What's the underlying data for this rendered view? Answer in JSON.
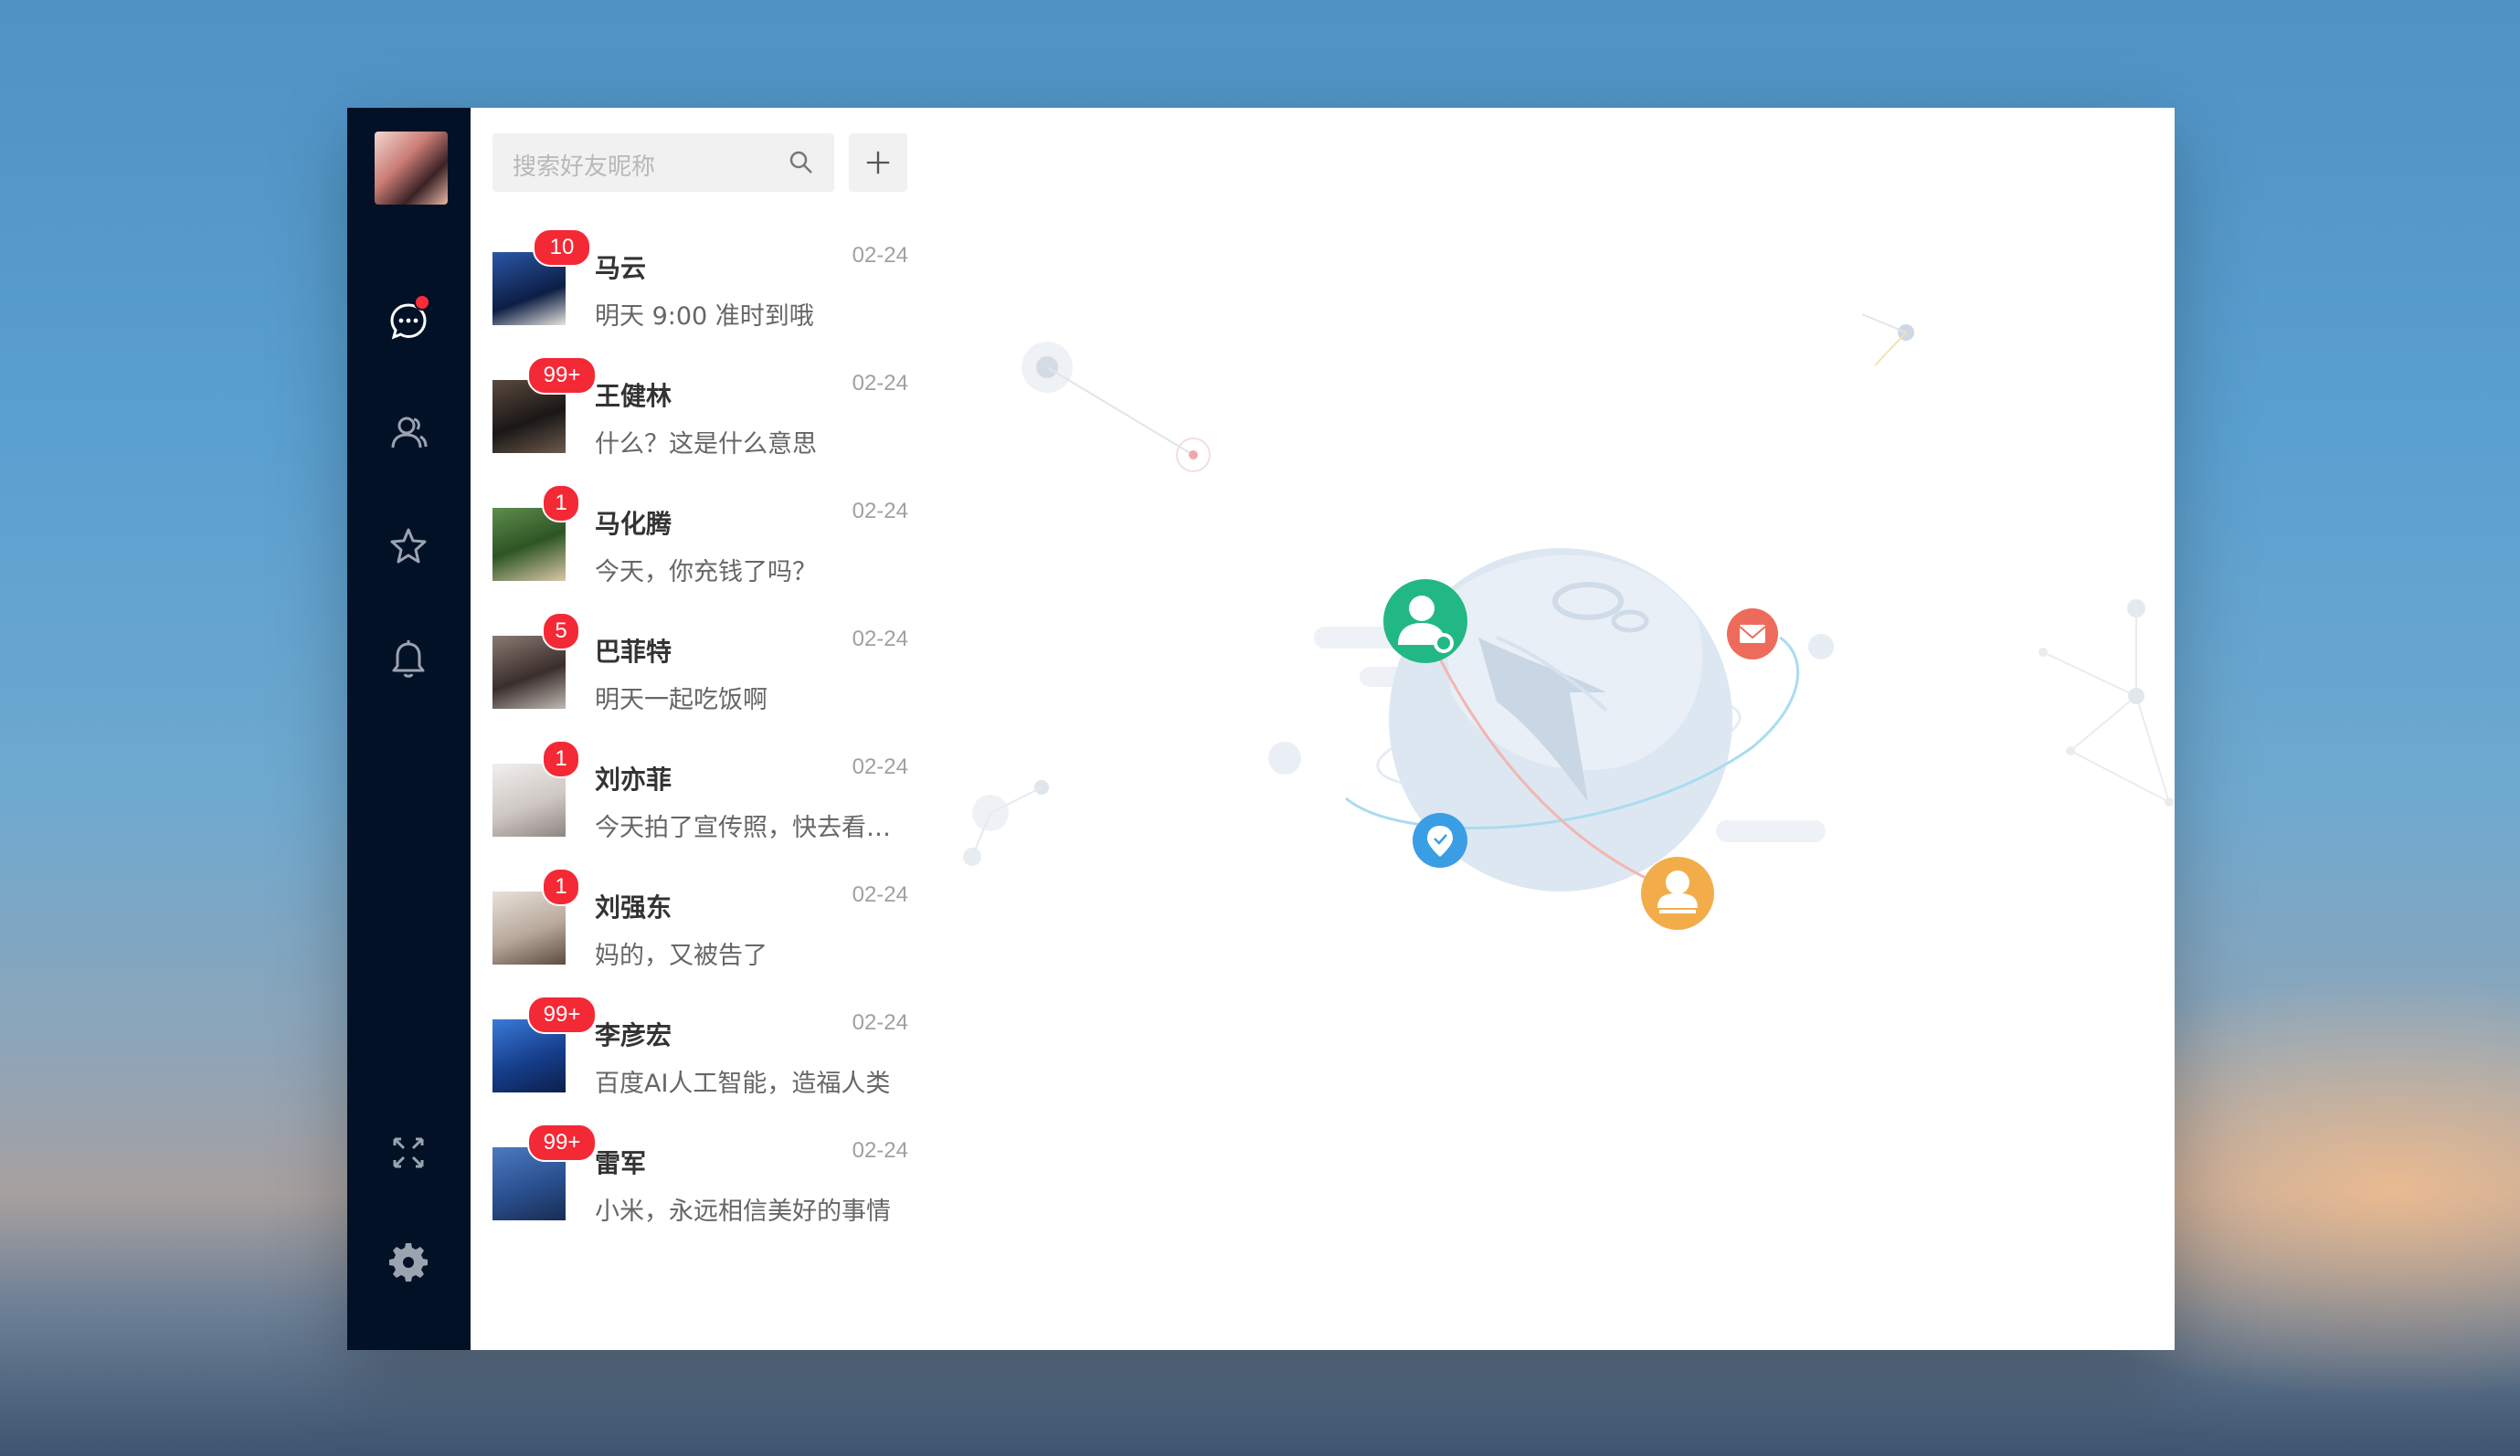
{
  "search": {
    "placeholder": "搜索好友昵称"
  },
  "conversations": [
    {
      "name": "马云",
      "time": "02-24",
      "message": "明天 9:00 准时到哦",
      "unread": "10",
      "avatar_color": "#1d3b78"
    },
    {
      "name": "王健林",
      "time": "02-24",
      "message": "什么？这是什么意思",
      "unread": "99+",
      "avatar_color": "#2a2622"
    },
    {
      "name": "马化腾",
      "time": "02-24",
      "message": "今天，你充钱了吗？",
      "unread": "1",
      "avatar_color": "#3f6e3a"
    },
    {
      "name": "巴菲特",
      "time": "02-24",
      "message": "明天一起吃饭啊",
      "unread": "5",
      "avatar_color": "#5a4a46"
    },
    {
      "name": "刘亦菲",
      "time": "02-24",
      "message": "今天拍了宣传照，快去看看吧",
      "unread": "1",
      "avatar_color": "#d7d4d2"
    },
    {
      "name": "刘强东",
      "time": "02-24",
      "message": "妈的，又被告了",
      "unread": "1",
      "avatar_color": "#b9b0a8"
    },
    {
      "name": "李彦宏",
      "time": "02-24",
      "message": "百度AI人工智能，造福人类",
      "unread": "99+",
      "avatar_color": "#1f4fa6"
    },
    {
      "name": "雷军",
      "time": "02-24",
      "message": "小米，永远相信美好的事情",
      "unread": "99+",
      "avatar_color": "#2f5a9e"
    }
  ],
  "colors": {
    "nav_bg": "#031127",
    "badge": "#f42936",
    "contact_green": "#22b885",
    "mail_red": "#ee6b5b",
    "location_blue": "#3a9ee4",
    "user_orange": "#f2ad4a"
  },
  "icons": [
    "chat-icon",
    "contacts-icon",
    "star-icon",
    "bell-icon",
    "fullscreen-icon",
    "settings-icon",
    "search-icon",
    "plus-icon"
  ]
}
